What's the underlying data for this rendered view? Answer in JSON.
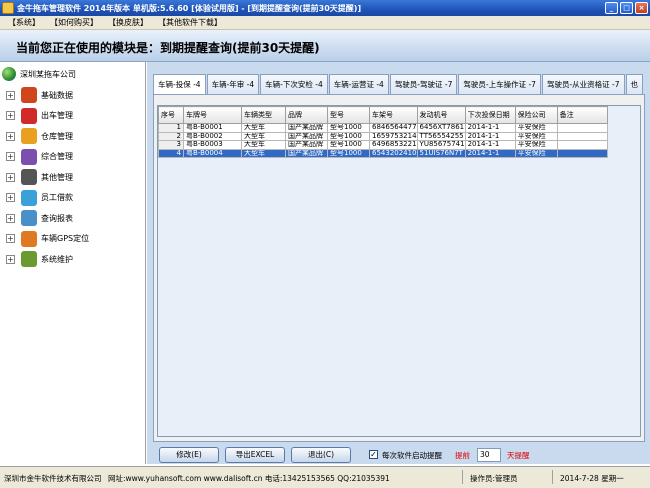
{
  "window": {
    "title": "金牛拖车管理软件 2014年版本 单机版:5.6.60 [体验试用版] - [到期提醒查询(提前30天提醒)]"
  },
  "menu": {
    "items": [
      "【系统】",
      "【如何购买】",
      "【换皮肤】",
      "【其他软件下载】"
    ]
  },
  "banner": {
    "text": "当前您正在使用的模块是：到期提醒查询(提前30天提醒)"
  },
  "sidebar": {
    "root": "深圳某拖车公司",
    "items": [
      {
        "label": "基础数据",
        "icon": "database-icon",
        "color": "#d0451b"
      },
      {
        "label": "出车管理",
        "icon": "truck-icon",
        "color": "#cf2b2b"
      },
      {
        "label": "仓库管理",
        "icon": "warehouse-icon",
        "color": "#e8a020"
      },
      {
        "label": "综合管理",
        "icon": "people-icon",
        "color": "#7a4fb0"
      },
      {
        "label": "其他管理",
        "icon": "gears-icon",
        "color": "#555555"
      },
      {
        "label": "员工借款",
        "icon": "puzzle-icon",
        "color": "#3aa0d8"
      },
      {
        "label": "查询报表",
        "icon": "magnifier-icon",
        "color": "#4a90c8"
      },
      {
        "label": "车辆GPS定位",
        "icon": "gps-icon",
        "color": "#e07a20"
      },
      {
        "label": "系统维护",
        "icon": "tools-icon",
        "color": "#6a9a30"
      }
    ]
  },
  "tabs": [
    "车辆-投保 -4",
    "车辆-年审 -4",
    "车辆-下次安检 -4",
    "车辆-运营证 -4",
    "驾驶员-驾驶证 -7",
    "驾驶员-上车操作证 -7",
    "驾驶员-从业资格证 -7",
    "也"
  ],
  "table": {
    "columns": [
      "序号",
      "车牌号",
      "车辆类型",
      "品牌",
      "型号",
      "车架号",
      "发动机号",
      "下次投保日期",
      "保险公司",
      "备注"
    ],
    "rows": [
      [
        "1",
        "粤B-B0001",
        "大型车",
        "国产某品牌",
        "型号1000",
        "6846564477",
        "6456XT7861",
        "2014-1-1",
        "平安保险",
        ""
      ],
      [
        "2",
        "粤B-B0002",
        "大型车",
        "国产某品牌",
        "型号1000",
        "1659753214",
        "TT56554255",
        "2014-1-1",
        "平安保险",
        ""
      ],
      [
        "3",
        "粤B-B0003",
        "大型车",
        "国产某品牌",
        "型号1000",
        "6496853221",
        "YU85675741",
        "2014-1-1",
        "平安保险",
        ""
      ],
      [
        "4",
        "粤B-B0004",
        "大型车",
        "国产某品牌",
        "型号1000",
        "6543202410",
        "51UIS76N7T",
        "2014-1-1",
        "平安保险",
        ""
      ]
    ],
    "selected_row": 4
  },
  "actions": {
    "edit": "修改(E)",
    "export": "导出EXCEL",
    "exit": "退出(C)",
    "startup_reminder": "每次软件启动提醒",
    "startup_reminder_checked": true,
    "advance_label": "提前",
    "advance_days": "30",
    "days_label": "天提醒"
  },
  "status": {
    "company": "深圳市金牛软件技术有限公司",
    "website": "网址:www.yuhansoft.com www.dalisoft.cn 电话:13425153565 QQ:21035391",
    "operator": "操作员:管理员",
    "date": "2014-7-28 星期一"
  }
}
